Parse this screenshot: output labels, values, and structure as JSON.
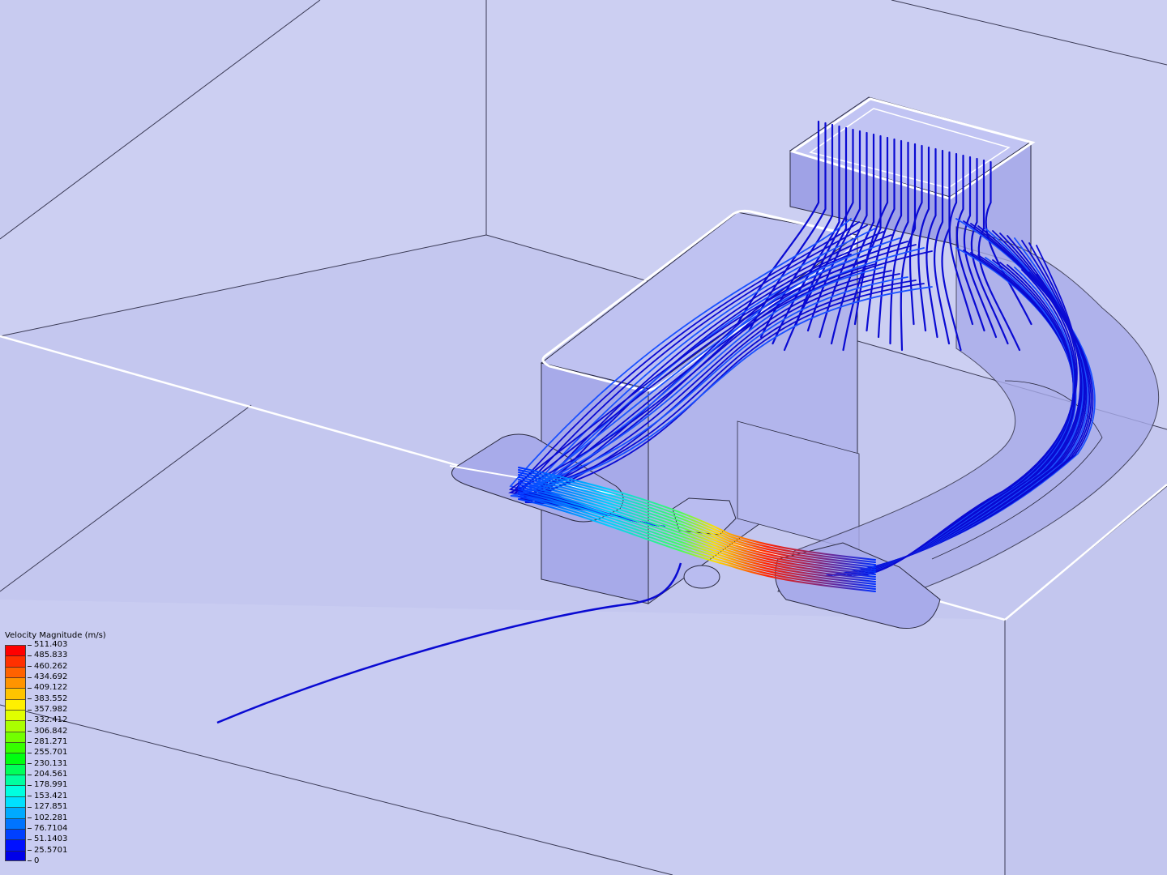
{
  "legend": {
    "title": "Velocity Magnitude (m/s)",
    "ticks": [
      "511.403",
      "485.833",
      "460.262",
      "434.692",
      "409.122",
      "383.552",
      "357.982",
      "332.412",
      "306.842",
      "281.271",
      "255.701",
      "230.131",
      "204.561",
      "178.991",
      "153.421",
      "127.851",
      "102.281",
      "76.7104",
      "51.1403",
      "25.5701",
      "0"
    ],
    "colors": [
      "#ff0000",
      "#ff3000",
      "#ff6200",
      "#ff9400",
      "#ffc400",
      "#fff000",
      "#e0ff00",
      "#aaff00",
      "#72ff00",
      "#36ff00",
      "#00ff10",
      "#00ff5a",
      "#00ffa0",
      "#00ffe0",
      "#00e0ff",
      "#00aaff",
      "#0074ff",
      "#0040ff",
      "#0010ff",
      "#0000e8"
    ]
  },
  "scene": {
    "background": "#cccff2",
    "streamline_low": "#0a0ad2",
    "edge_color": "#1e1e30",
    "highlight": "#ffffff"
  }
}
